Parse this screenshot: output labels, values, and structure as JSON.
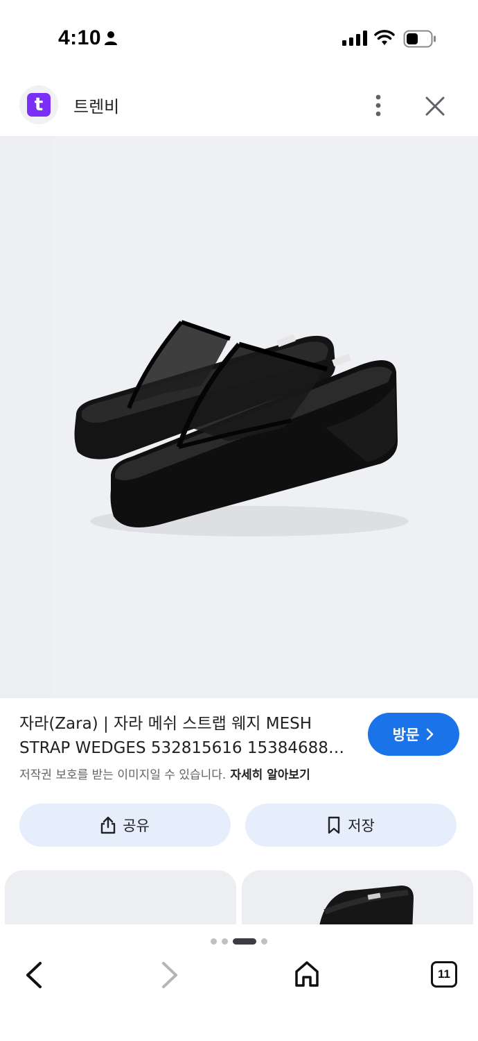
{
  "status_bar": {
    "time": "4:10"
  },
  "header": {
    "logo_letter": "t",
    "logo_color": "#7b2ff7",
    "title": "트렌비"
  },
  "image": {
    "description_icon": "black-mesh-wedge-sandals"
  },
  "info": {
    "title_line1": "자라(Zara) | 자라 메쉬 스트랩 웨지 MESH",
    "title_line2": "STRAP WEDGES 532815616 153846883…",
    "copyright_text": "저작권 보호를 받는 이미지일 수 있습니다.",
    "learn_more": "자세히 알아보기",
    "visit_label": "방문",
    "accent_color": "#1a73e8"
  },
  "actions": {
    "share_label": "공유",
    "save_label": "저장"
  },
  "browser": {
    "tab_count": "11",
    "page_indicator_count": 4,
    "active_page_index": 2
  }
}
